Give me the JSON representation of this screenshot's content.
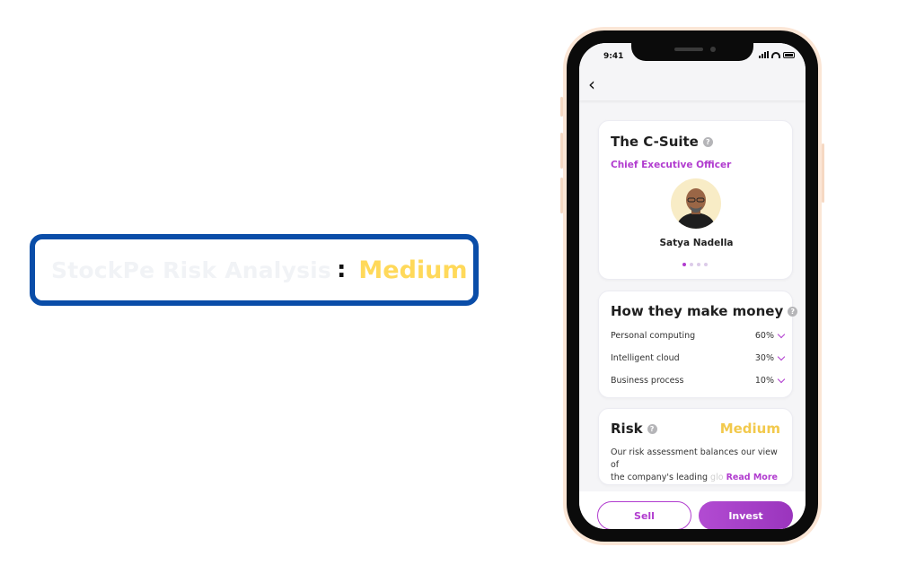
{
  "callout": {
    "label": "StockPe Risk Analysis",
    "separator": ":",
    "value": "Medium"
  },
  "status_bar": {
    "time": "9:41"
  },
  "csuite": {
    "title": "The C-Suite",
    "role": "Chief Executive Officer",
    "name": "Satya Nadella",
    "carousel_total": 4,
    "carousel_active": 1
  },
  "revenue": {
    "title": "How they make money",
    "items": [
      {
        "name": "Personal computing",
        "percent": "60%"
      },
      {
        "name": "Intelligent cloud",
        "percent": "30%"
      },
      {
        "name": "Business process",
        "percent": "10%"
      }
    ]
  },
  "risk": {
    "title": "Risk",
    "level": "Medium",
    "text_line1": "Our risk assessment balances our view of",
    "text_line2": "the company's leading",
    "text_faded": "glo",
    "read_more": "Read More"
  },
  "actions": {
    "sell_label": "Sell",
    "invest_label": "Invest"
  },
  "colors": {
    "accent": "#b13ccf",
    "risk_medium": "#f2c94c",
    "callout_border": "#0a4da8",
    "callout_value": "#ffd95a"
  }
}
